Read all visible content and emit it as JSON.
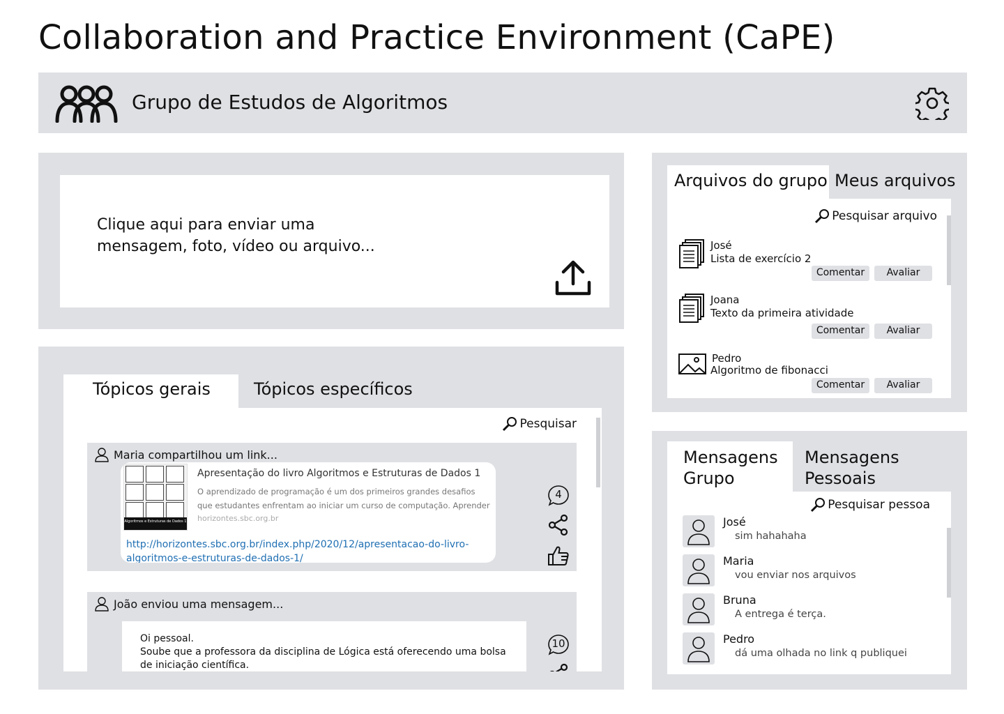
{
  "app": {
    "title": "Collaboration and Practice Environment (CaPE)"
  },
  "header": {
    "group_name": "Grupo de Estudos de Algoritmos",
    "group_icon": "users-icon",
    "settings_icon": "gear-icon"
  },
  "upload": {
    "prompt": "Clique aqui para enviar uma mensagem, foto, vídeo ou arquivo...",
    "icon": "upload-icon"
  },
  "topics": {
    "tabs": [
      {
        "label": "Tópicos gerais",
        "active": true
      },
      {
        "label": "Tópicos específicos",
        "active": false
      }
    ],
    "search_label": "Pesquisar",
    "posts": [
      {
        "author_line": "Maria compartilhou um link...",
        "link_title": "Apresentação do livro Algoritmos e Estruturas de Dados 1",
        "link_description": "O aprendizado de programação é um dos primeiros grandes desafios que estudantes enfrentam ao iniciar um curso de computação. Aprender",
        "link_domain": "horizontes.sbc.org.br",
        "thumb_caption": "Algoritmos e Estruturas de Dados 1",
        "link_url": "http://horizontes.sbc.org.br/index.php/2020/12/apresentacao-do-livro-algoritmos-e-estruturas-de-dados-1/",
        "comment_count": "4"
      },
      {
        "author_line": "João enviou uma mensagem...",
        "message": "Oi pessoal.\nSoube que a professora da disciplina de Lógica está oferecendo uma bolsa de iniciação científica.",
        "comment_count": "10"
      }
    ]
  },
  "files": {
    "tabs": [
      {
        "label": "Arquivos do grupo",
        "active": true
      },
      {
        "label": "Meus arquivos",
        "active": false
      }
    ],
    "search_label": "Pesquisar arquivo",
    "comment_label": "Comentar",
    "rate_label": "Avaliar",
    "items": [
      {
        "author": "José",
        "title": "Lista de exercício 2",
        "icon": "document-icon"
      },
      {
        "author": "Joana",
        "title": "Texto da primeira atividade",
        "icon": "document-icon"
      },
      {
        "author": "Pedro",
        "title": "Algoritmo de fibonacci",
        "icon": "image-icon"
      }
    ]
  },
  "messages": {
    "tabs": [
      {
        "label": "Mensagens Grupo",
        "active": true
      },
      {
        "label": "Mensagens Pessoais",
        "active": false
      }
    ],
    "search_label": "Pesquisar pessoa",
    "items": [
      {
        "name": "José",
        "preview": "sim hahahaha"
      },
      {
        "name": "Maria",
        "preview": "vou enviar nos arquivos"
      },
      {
        "name": "Bruna",
        "preview": "A entrega é terça."
      },
      {
        "name": "Pedro",
        "preview": "dá uma olhada no link q publiquei"
      }
    ]
  },
  "colors": {
    "panel_bg": "#dfe0e4",
    "link": "#1f6fb3",
    "text": "#111111"
  }
}
